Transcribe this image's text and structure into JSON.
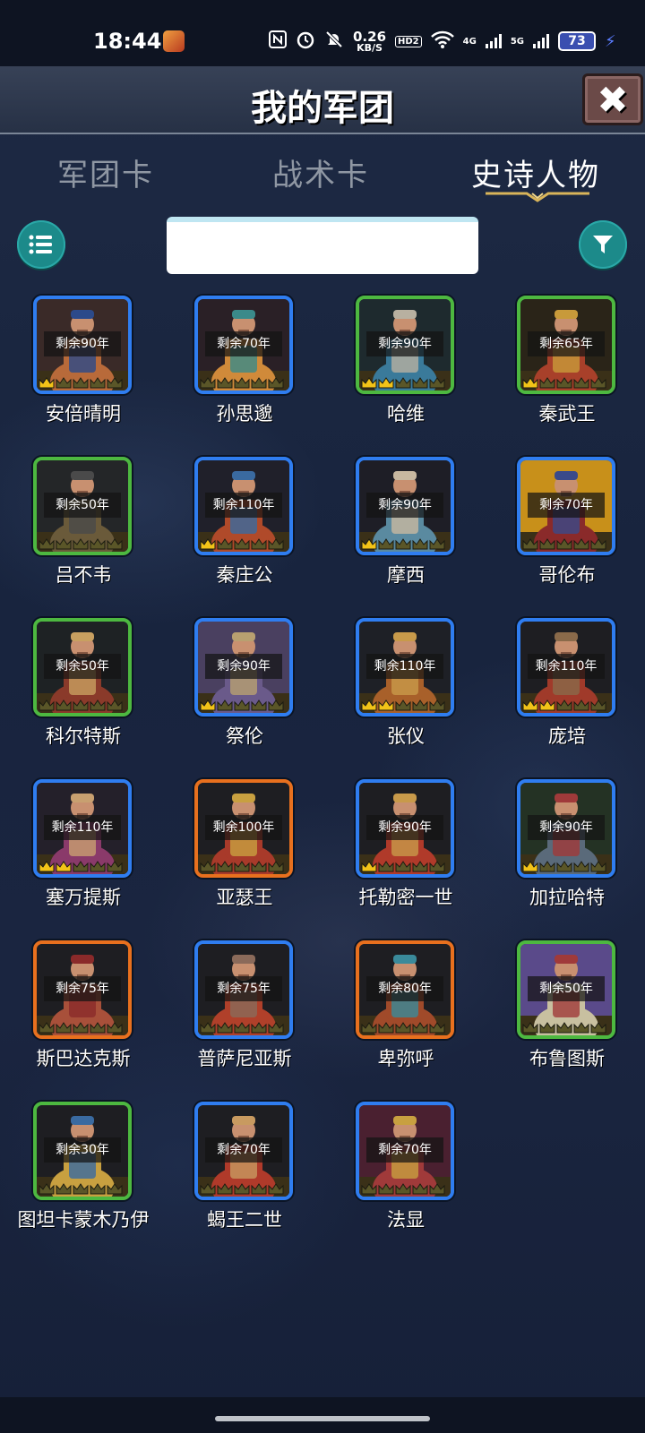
{
  "status_bar": {
    "time": "18:44",
    "net_speed_top": "0.26",
    "net_speed_bottom": "KB/S",
    "hd_label": "HD2",
    "net_4g": "4G",
    "net_5g": "5G",
    "battery": "73",
    "icons": [
      "nfc-icon",
      "alarm-icon",
      "mute-icon",
      "wifi-icon",
      "signal-icon",
      "battery-icon",
      "charging-icon"
    ]
  },
  "header": {
    "title": "我的军团",
    "close_icon": "close-icon"
  },
  "tabs": [
    {
      "label": "军团卡",
      "active": false
    },
    {
      "label": "战术卡",
      "active": false
    },
    {
      "label": "史诗人物",
      "active": true
    }
  ],
  "toolbar": {
    "list_icon": "list-icon",
    "filter_icon": "filter-icon",
    "search_value": "",
    "search_placeholder": ""
  },
  "characters": [
    {
      "name": "安倍晴明",
      "remain": "剩余90年",
      "frame": "blue",
      "crowns": 1,
      "palette": [
        "#3a2a28",
        "#b86a3a",
        "#2c4a8a"
      ]
    },
    {
      "name": "孙思邈",
      "remain": "剩余70年",
      "frame": "blue",
      "crowns": 0,
      "palette": [
        "#2a2026",
        "#d08a3a",
        "#3a8a8a"
      ]
    },
    {
      "name": "哈维",
      "remain": "剩余90年",
      "frame": "green",
      "crowns": 2,
      "palette": [
        "#1e2a2e",
        "#3a7a9a",
        "#b8b0a0"
      ]
    },
    {
      "name": "秦武王",
      "remain": "剩余65年",
      "frame": "green",
      "crowns": 1,
      "palette": [
        "#2a2418",
        "#a8402a",
        "#c89a3a"
      ]
    },
    {
      "name": "吕不韦",
      "remain": "剩余50年",
      "frame": "green",
      "crowns": 0,
      "palette": [
        "#242628",
        "#6a5a3a",
        "#4a4a4a"
      ]
    },
    {
      "name": "秦庄公",
      "remain": "剩余110年",
      "frame": "blue",
      "crowns": 1,
      "palette": [
        "#20202a",
        "#b04a2a",
        "#3a6aa0"
      ]
    },
    {
      "name": "摩西",
      "remain": "剩余90年",
      "frame": "blue",
      "crowns": 1,
      "palette": [
        "#1e1e26",
        "#5a8aa0",
        "#c8b8a0"
      ]
    },
    {
      "name": "哥伦布",
      "remain": "剩余70年",
      "frame": "blue",
      "crowns": 0,
      "palette": [
        "#c8901a",
        "#8a2a2a",
        "#3a4a8a"
      ]
    },
    {
      "name": "科尔特斯",
      "remain": "剩余50年",
      "frame": "green",
      "crowns": 0,
      "palette": [
        "#1e2224",
        "#8a3a2a",
        "#c8a060"
      ]
    },
    {
      "name": "祭伦",
      "remain": "剩余90年",
      "frame": "blue",
      "crowns": 1,
      "palette": [
        "#4a4060",
        "#6a5a8a",
        "#b8a070"
      ]
    },
    {
      "name": "张仪",
      "remain": "剩余110年",
      "frame": "blue",
      "crowns": 2,
      "palette": [
        "#1e2026",
        "#a8602a",
        "#c89a4a"
      ]
    },
    {
      "name": "庞培",
      "remain": "剩余110年",
      "frame": "blue",
      "crowns": 2,
      "palette": [
        "#1e1e22",
        "#a03a2a",
        "#8a6a4a"
      ]
    },
    {
      "name": "塞万提斯",
      "remain": "剩余110年",
      "frame": "blue",
      "crowns": 2,
      "palette": [
        "#24202a",
        "#8a3a6a",
        "#c8a070"
      ]
    },
    {
      "name": "亚瑟王",
      "remain": "剩余100年",
      "frame": "orange",
      "crowns": 0,
      "palette": [
        "#1e1e22",
        "#a83a2a",
        "#c8a040"
      ]
    },
    {
      "name": "托勒密一世",
      "remain": "剩余90年",
      "frame": "blue",
      "crowns": 1,
      "palette": [
        "#1e1e22",
        "#b03a2a",
        "#c89a4a"
      ]
    },
    {
      "name": "加拉哈特",
      "remain": "剩余90年",
      "frame": "blue",
      "crowns": 1,
      "palette": [
        "#243224",
        "#5a6a7a",
        "#a03a3a"
      ]
    },
    {
      "name": "斯巴达克斯",
      "remain": "剩余75年",
      "frame": "orange",
      "crowns": 0,
      "palette": [
        "#1e1e22",
        "#a8503a",
        "#8a2a2a"
      ]
    },
    {
      "name": "普萨尼亚斯",
      "remain": "剩余75年",
      "frame": "blue",
      "crowns": 0,
      "palette": [
        "#1e1e22",
        "#b0402a",
        "#8a6a5a"
      ]
    },
    {
      "name": "卑弥呼",
      "remain": "剩余80年",
      "frame": "orange",
      "crowns": 0,
      "palette": [
        "#1e1e22",
        "#a04a2a",
        "#3a8a9a"
      ]
    },
    {
      "name": "布鲁图斯",
      "remain": "剩余50年",
      "frame": "green",
      "crowns": 0,
      "palette": [
        "#5a4a8a",
        "#c8c0a0",
        "#a03a3a"
      ]
    },
    {
      "name": "图坦卡蒙木乃伊",
      "remain": "剩余30年",
      "frame": "green",
      "crowns": 0,
      "palette": [
        "#1e1e22",
        "#c8a040",
        "#3a6aa0"
      ]
    },
    {
      "name": "蝎王二世",
      "remain": "剩余70年",
      "frame": "blue",
      "crowns": 0,
      "palette": [
        "#1e1e22",
        "#b03a2a",
        "#c89a60"
      ]
    },
    {
      "name": "法显",
      "remain": "剩余70年",
      "frame": "blue",
      "crowns": 0,
      "palette": [
        "#4a2030",
        "#a03a3a",
        "#c8a040"
      ]
    }
  ]
}
